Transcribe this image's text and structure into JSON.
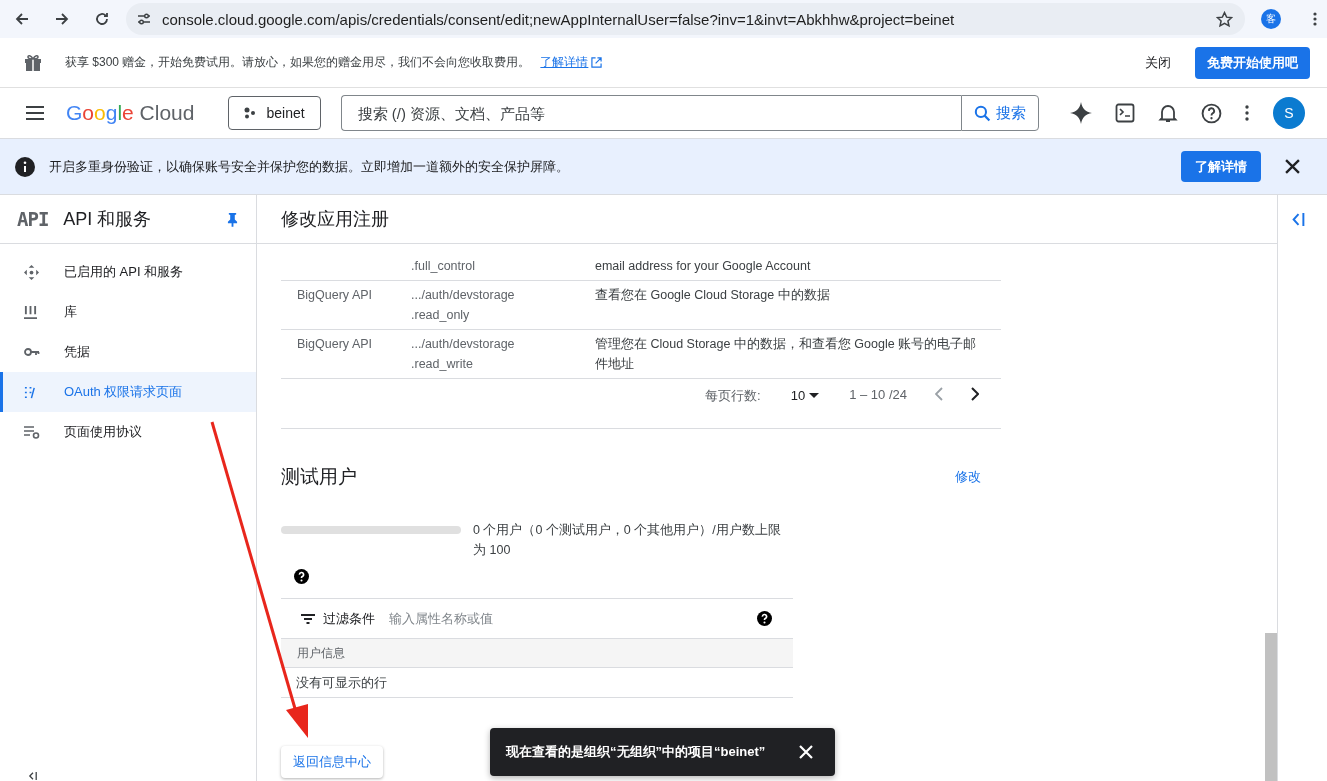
{
  "browser": {
    "url": "console.cloud.google.com/apis/credentials/consent/edit;newAppInternalUser=false?inv=1&invt=Abkhhw&project=beinet",
    "profile": "客"
  },
  "promo": {
    "text": "获享 $300 赠金，开始免费试用。请放心，如果您的赠金用尽，我们不会向您收取费用。",
    "link": "了解详情",
    "dismiss": "关闭",
    "cta": "免费开始使用吧"
  },
  "header": {
    "logo_google": "Google",
    "logo_cloud": "Cloud",
    "project": "beinet",
    "search_placeholder": "搜索 (/) 资源、文档、产品等",
    "search_button": "搜索",
    "avatar": "S"
  },
  "banner": {
    "text": "开启多重身份验证，以确保账号安全并保护您的数据。立即增加一道额外的安全保护屏障。",
    "button": "了解详情"
  },
  "sidebar": {
    "logo": "API",
    "title": "API 和服务",
    "items": [
      {
        "label": "已启用的 API 和服务",
        "selected": false
      },
      {
        "label": "库",
        "selected": false
      },
      {
        "label": "凭据",
        "selected": false
      },
      {
        "label": "OAuth 权限请求页面",
        "selected": true
      },
      {
        "label": "页面使用协议",
        "selected": false
      }
    ]
  },
  "main": {
    "title": "修改应用注册",
    "scopes": [
      {
        "scope_lines": [
          ".full_control"
        ],
        "description": "email address for your Google Account"
      },
      {
        "api": "BigQuery API",
        "scope_lines": [
          ".../auth/devstorage",
          ".read_only"
        ],
        "description": "查看您在 Google Cloud Storage 中的数据"
      },
      {
        "api": "BigQuery API",
        "scope_lines": [
          ".../auth/devstorage",
          ".read_write"
        ],
        "description": "管理您在 Cloud Storage 中的数据，和查看您 Google 账号的电子邮件地址"
      }
    ],
    "pagination": {
      "rows_label": "每页行数:",
      "rows_value": "10",
      "range": "1 – 10 /24"
    },
    "test_users": {
      "title": "测试用户",
      "edit": "修改",
      "level": 0,
      "usage": "0 个用户（0 个测试用户，0 个其他用户）/用户数上限为 100",
      "filter_label": "过滤条件",
      "filter_placeholder": "输入属性名称或值",
      "column": "用户信息",
      "empty": "没有可显示的行"
    },
    "back_button": "返回信息中心"
  },
  "toast": {
    "text": "现在查看的是组织“无组织”中的项目“beinet”"
  }
}
